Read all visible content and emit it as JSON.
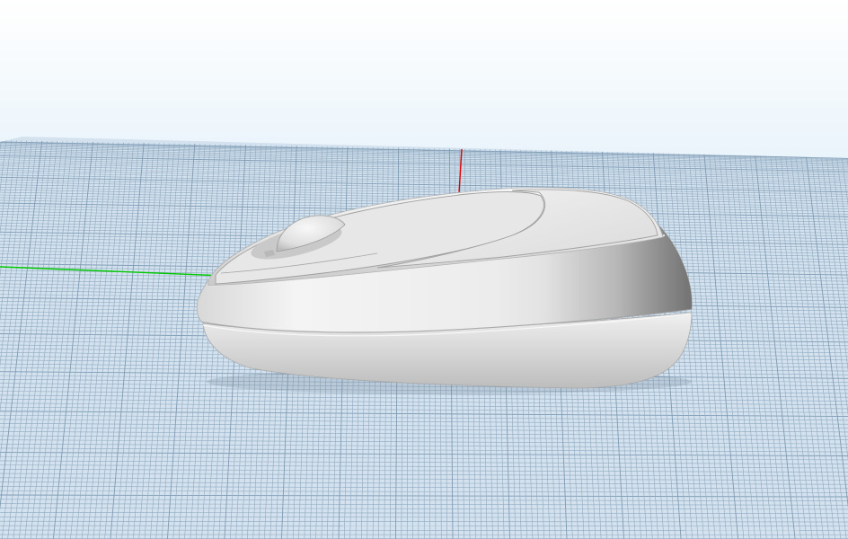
{
  "viewport": {
    "background": {
      "top_color": "#ffffff",
      "bottom_color": "#b7d9f1"
    },
    "ground_plane": {
      "fill_color": "#d3e2ee",
      "grid_color": "#90aac0",
      "major_grid_color": "#7f9bb3"
    },
    "axes": {
      "x_axis_color": "#00c800",
      "z_axis_color": "#e00000"
    },
    "model": {
      "name": "",
      "base_color": "#d4d4d4",
      "highlight_color": "#f7f7f7",
      "shadow_color": "#9a9a9a"
    }
  }
}
